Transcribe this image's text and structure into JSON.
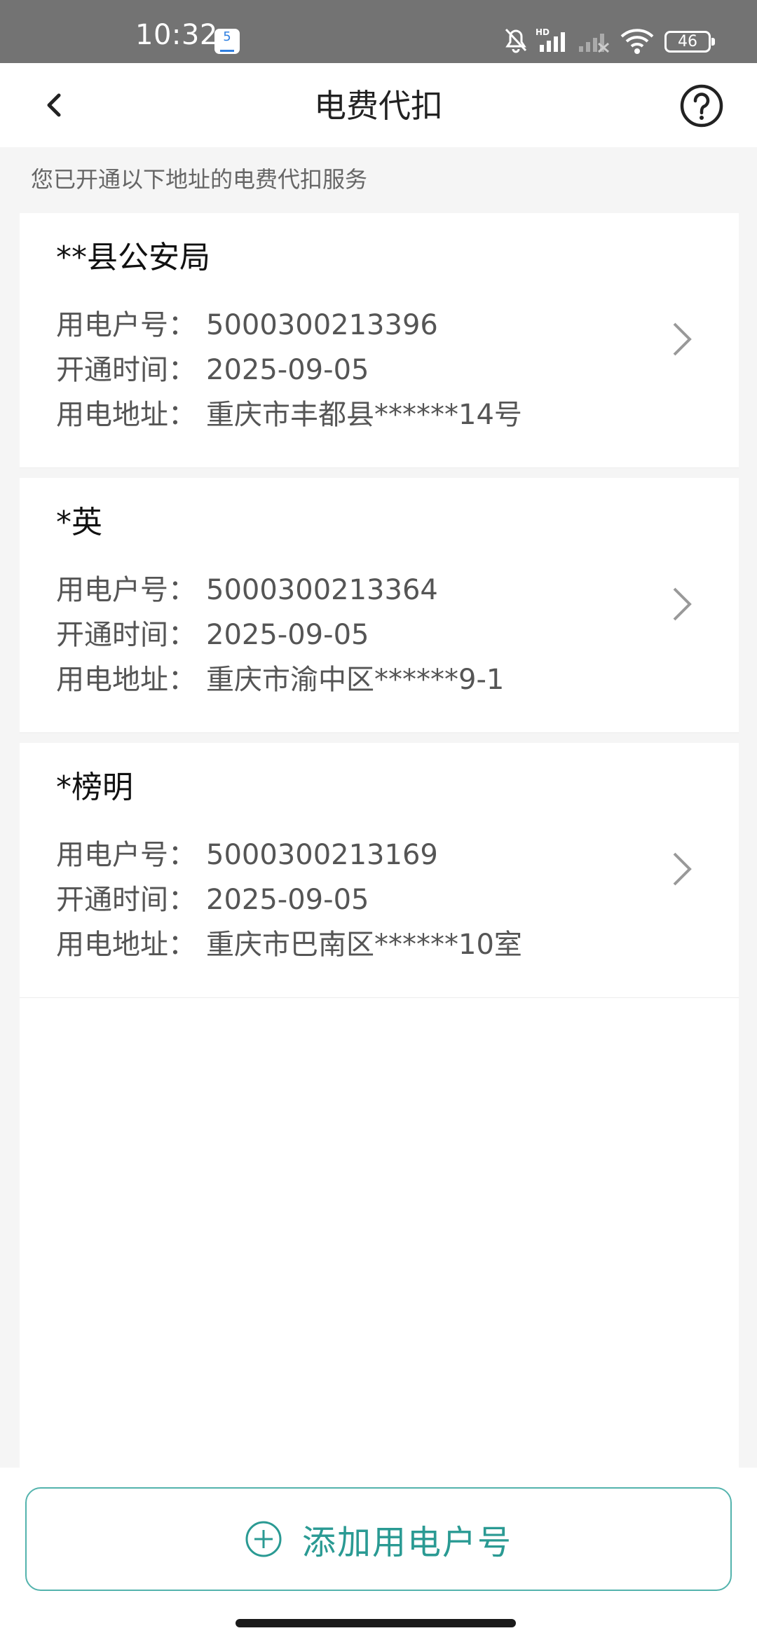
{
  "status_bar": {
    "time": "10:32",
    "notification_badge": "5",
    "battery": "46",
    "icons": [
      "bell-off-icon",
      "hd-signal-icon",
      "signal-bars-icon",
      "signal-weak-icon",
      "wifi-icon",
      "battery-icon"
    ]
  },
  "nav": {
    "title": "电费代扣",
    "back_icon": "chevron-left-icon",
    "help_icon": "question-circle-icon"
  },
  "subtitle": "您已开通以下地址的电费代扣服务",
  "labels": {
    "account_no": "用电户号：",
    "open_time": "开通时间：",
    "address": "用电地址："
  },
  "accounts": [
    {
      "name": "**县公安局",
      "account_no": "5000300213396",
      "open_time": "2025-09-05",
      "address": "重庆市丰都县******14号"
    },
    {
      "name": "*英",
      "account_no": "5000300213364",
      "open_time": "2025-09-05",
      "address": "重庆市渝中区******9-1"
    },
    {
      "name": "*榜明",
      "account_no": "5000300213169",
      "open_time": "2025-09-05",
      "address": "重庆市巴南区******10室"
    }
  ],
  "add_button": {
    "label": "添加用电户号",
    "icon": "plus-circle-icon"
  },
  "colors": {
    "accent": "#2a9a93",
    "status_bar": "#737373",
    "background": "#f5f5f5"
  }
}
